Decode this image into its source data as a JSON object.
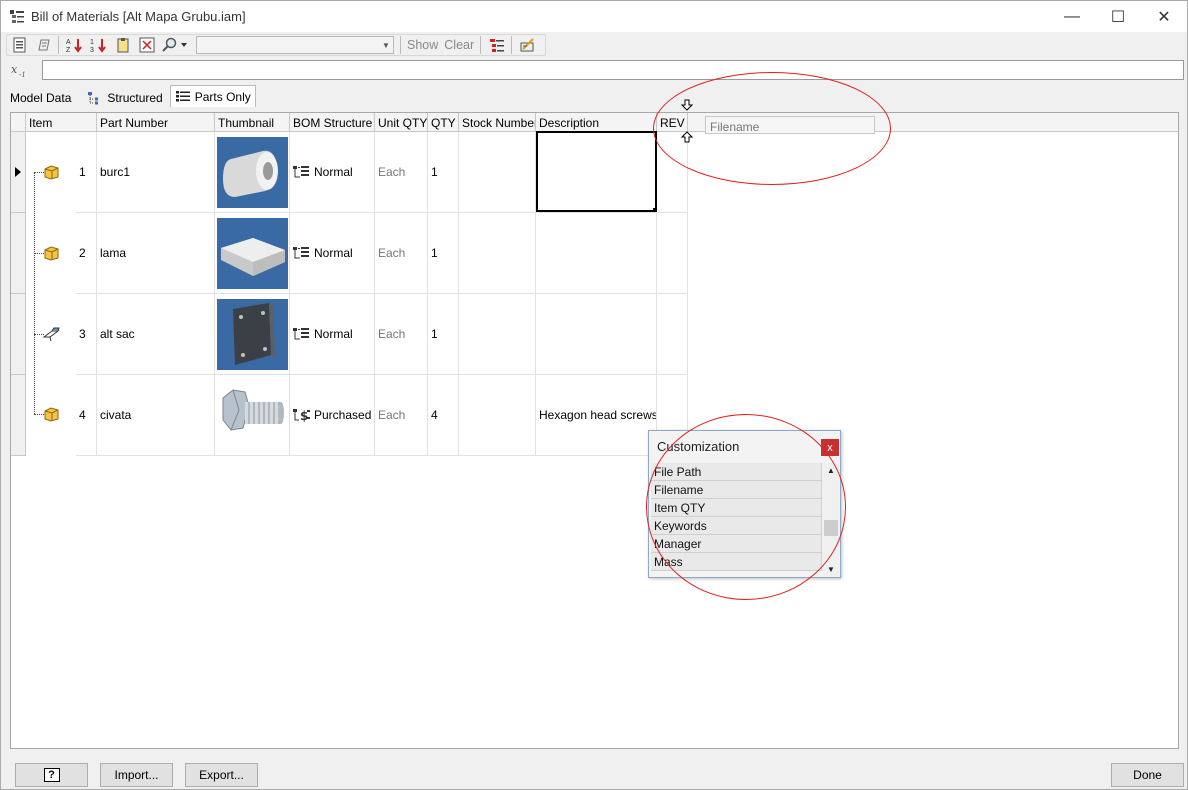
{
  "window": {
    "title": "Bill of Materials [Alt Mapa Grubu.iam]",
    "controls": {
      "minimize": "—",
      "maximize": "☐",
      "close": "✕"
    }
  },
  "toolbar": {
    "combo_value": "",
    "show_label": "Show",
    "clear_label": "Clear"
  },
  "formula_bar": {
    "fx_label": "x",
    "value": ""
  },
  "tabs": [
    {
      "label": "Model Data",
      "active": false
    },
    {
      "label": "Structured",
      "active": false
    },
    {
      "label": "Parts Only",
      "active": true
    }
  ],
  "columns": [
    "Item",
    "Part Number",
    "Thumbnail",
    "BOM Structure",
    "Unit QTY",
    "QTY",
    "Stock Number",
    "Description",
    "REV"
  ],
  "rows": [
    {
      "item": "1",
      "part_number": "burc1",
      "bom_structure": "Normal",
      "unit_qty": "Each",
      "qty": "1",
      "stock_number": "",
      "description": "",
      "rev": ""
    },
    {
      "item": "2",
      "part_number": "lama",
      "bom_structure": "Normal",
      "unit_qty": "Each",
      "qty": "1",
      "stock_number": "",
      "description": "",
      "rev": ""
    },
    {
      "item": "3",
      "part_number": "alt sac",
      "bom_structure": "Normal",
      "unit_qty": "Each",
      "qty": "1",
      "stock_number": "",
      "description": "",
      "rev": ""
    },
    {
      "item": "4",
      "part_number": "civata",
      "bom_structure": "Purchased",
      "unit_qty": "Each",
      "qty": "4",
      "stock_number": "",
      "description": "Hexagon head screws",
      "rev": ""
    }
  ],
  "drag_column": {
    "label": "Filename"
  },
  "customization": {
    "title": "Customization",
    "close_label": "x",
    "items": [
      "File Path",
      "Filename",
      "Item QTY",
      "Keywords",
      "Manager",
      "Mass"
    ]
  },
  "footer": {
    "help_label": "?",
    "import_label": "Import...",
    "export_label": "Export...",
    "done_label": "Done"
  },
  "colors": {
    "annotation_red": "#e02020",
    "thumbnail_bg": "#3a6aa3",
    "part_icon": "#f5c242"
  }
}
